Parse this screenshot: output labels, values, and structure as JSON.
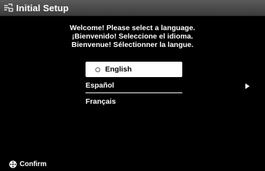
{
  "window": {
    "title": "Initial Setup"
  },
  "welcome": {
    "line1": "Welcome! Please select a language.",
    "line2": "¡Bienvenido! Seleccione el idioma.",
    "line3": "Bienvenue! Sélectionner la langue."
  },
  "languages": [
    {
      "label": "English",
      "selected": true
    },
    {
      "label": "Español",
      "selected": false
    },
    {
      "label": "Français",
      "selected": false
    }
  ],
  "footer": {
    "confirm_label": "Confirm"
  },
  "icons": {
    "title": "setup-icon",
    "next": "right-arrow-icon",
    "confirm": "dpad-center-icon"
  },
  "colors": {
    "background": "#000000",
    "title_bar": "#4a4a4a",
    "text": "#ffffff",
    "highlight": "#ffffff"
  }
}
